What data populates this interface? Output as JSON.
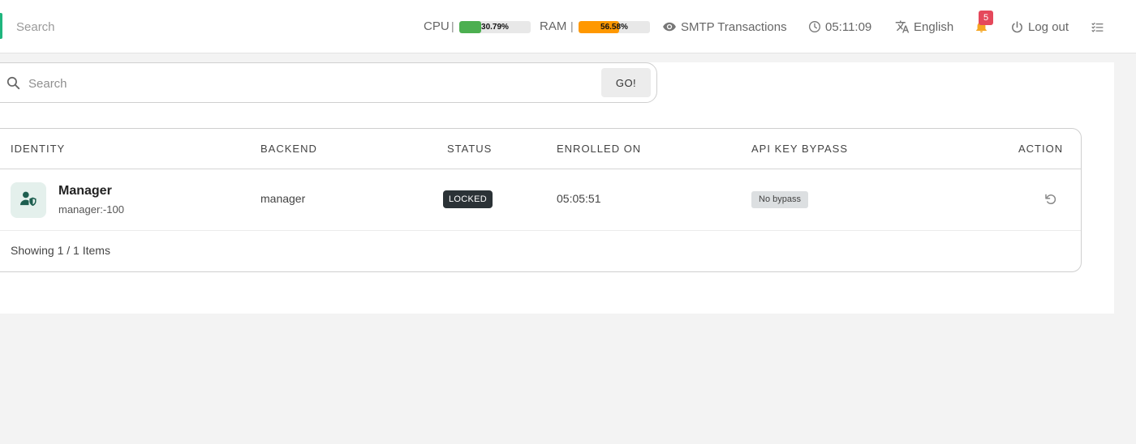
{
  "header": {
    "search_placeholder": "Search",
    "cpu": {
      "label": "CPU",
      "separator": "|",
      "percent": 30.79,
      "text": "30.79%",
      "color": "#4caf50"
    },
    "ram": {
      "label": "RAM",
      "separator": "|",
      "percent": 56.58,
      "text": "56.58%",
      "color": "#ff9800"
    },
    "smtp_label": "SMTP Transactions",
    "clock": "05:11:09",
    "language": "English",
    "notifications_count": "5",
    "logout_label": "Log out"
  },
  "search": {
    "placeholder": "Search",
    "go_label": "GO!"
  },
  "table": {
    "headers": {
      "identity": "IDENTITY",
      "backend": "BACKEND",
      "status": "STATUS",
      "enrolled_on": "ENROLLED ON",
      "api_key_bypass": "API KEY BYPASS",
      "action": "ACTION"
    },
    "rows": [
      {
        "name": "Manager",
        "sub": "manager:-100",
        "backend": "manager",
        "status": "LOCKED",
        "enrolled_on": "05:05:51",
        "bypass": "No bypass"
      }
    ],
    "footer": "Showing 1 / 1 Items"
  },
  "colors": {
    "accent": "#1fb57e",
    "badge": "#e5485b",
    "notification_icon": "#f5a623",
    "status_locked_bg": "#2b3236",
    "avatar_icon": "#1d5e4f"
  },
  "icons": {
    "smtp": "eye-icon",
    "clock": "clock-icon",
    "language": "translate-icon",
    "notifications": "bell-icon",
    "logout": "power-icon",
    "tasks": "checklist-icon",
    "search": "search-icon",
    "avatar": "user-shield-icon",
    "action": "restore-icon"
  }
}
